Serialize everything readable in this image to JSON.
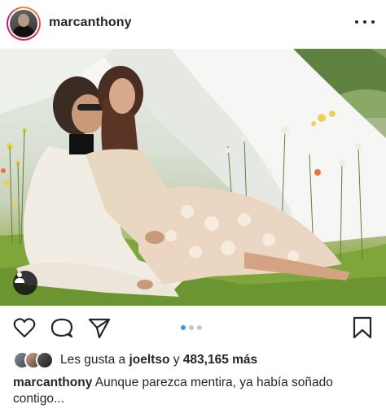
{
  "post": {
    "username": "marcanthony",
    "likes": {
      "prefix": "Les gusta a",
      "first_liker": "joeltso",
      "connector": "y",
      "count": "483,165",
      "suffix": "más"
    },
    "caption": {
      "username": "marcanthony",
      "text": "Aunque parezca mentira, ya había soñado contigo..."
    },
    "carousel": {
      "total": 3,
      "current": 1
    }
  },
  "colors": {
    "dot_active": "#3897f0",
    "dot_inactive": "#c7c7c7",
    "text": "#262626"
  },
  "icons": {
    "like": "heart-icon",
    "comment": "comment-icon",
    "share": "paper-plane-icon",
    "save": "bookmark-icon",
    "more": "more-horizontal-icon",
    "tags": "user-tag-icon"
  }
}
